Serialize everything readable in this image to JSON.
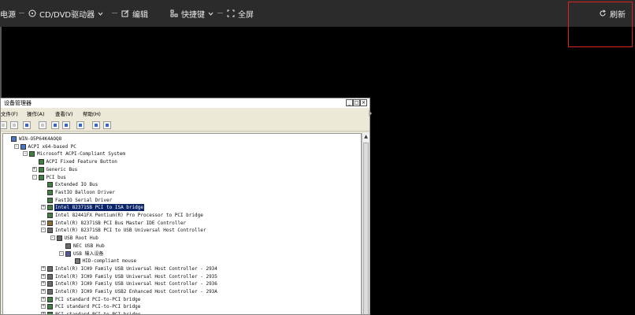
{
  "toolbar": {
    "cd_drive": "CD/DVD驱动器",
    "edit": "编辑",
    "shortcut": "快捷键",
    "fullscreen": "全屏",
    "refresh": "刷新",
    "power": "电源"
  },
  "window": {
    "title": "设备管理器",
    "controls": [
      "_",
      "□",
      "×"
    ],
    "menu": [
      "文件(F)",
      "操作(A)",
      "查看(V)",
      "帮助(H)"
    ]
  },
  "tree": [
    {
      "label": "WIN-O5P64K4AOQ8",
      "level": 0,
      "exp": "",
      "icon": "computer"
    },
    {
      "label": "ACPI x64-based PC",
      "level": 1,
      "exp": "-",
      "icon": "computer"
    },
    {
      "label": "Microsoft ACPI-Compliant System",
      "level": 2,
      "exp": "-",
      "icon": "chip"
    },
    {
      "label": "ACPI Fixed Feature Button",
      "level": 3,
      "exp": "",
      "icon": "chip"
    },
    {
      "label": "Generic Bus",
      "level": 3,
      "exp": "+",
      "icon": "chip"
    },
    {
      "label": "PCI bus",
      "level": 3,
      "exp": "-",
      "icon": "chip"
    },
    {
      "label": "Extended IO Bus",
      "level": 4,
      "exp": "",
      "icon": "chip"
    },
    {
      "label": "FastIO Balloon Driver",
      "level": 4,
      "exp": "",
      "icon": "chip"
    },
    {
      "label": "FastIO Serial Driver",
      "level": 4,
      "exp": "",
      "icon": "chip"
    },
    {
      "label": "Intel 82371SB PCI to ISA bridge",
      "level": 4,
      "exp": "+",
      "icon": "chip",
      "selected": true
    },
    {
      "label": "Intel 82441FX Pentium(R) Pro Processor to PCI bridge",
      "level": 4,
      "exp": "",
      "icon": "chip"
    },
    {
      "label": "Intel(R) 82371SB PCI Bus Master IDE Controller",
      "level": 4,
      "exp": "+",
      "icon": "disk"
    },
    {
      "label": "Intel(R) 82371SB PCI to USB Universal Host Controller",
      "level": 4,
      "exp": "-",
      "icon": "usb"
    },
    {
      "label": "USB Root Hub",
      "level": 5,
      "exp": "-",
      "icon": "usb"
    },
    {
      "label": "NEC USB Hub",
      "level": 6,
      "exp": "",
      "icon": "usb"
    },
    {
      "label": "USB 输入设备",
      "level": 6,
      "exp": "-",
      "icon": "input"
    },
    {
      "label": "HID-compliant mouse",
      "level": 7,
      "exp": "",
      "icon": "mouse"
    },
    {
      "label": "Intel(R) ICH9 Family USB Universal Host Controller - 2934",
      "level": 4,
      "exp": "+",
      "icon": "usb"
    },
    {
      "label": "Intel(R) ICH9 Family USB Universal Host Controller - 2935",
      "level": 4,
      "exp": "+",
      "icon": "usb"
    },
    {
      "label": "Intel(R) ICH9 Family USB Universal Host Controller - 2936",
      "level": 4,
      "exp": "+",
      "icon": "usb"
    },
    {
      "label": "Intel(R) ICH9 Family USB2 Enhanced Host Controller - 293A",
      "level": 4,
      "exp": "+",
      "icon": "usb"
    },
    {
      "label": "PCI standard PCI-to-PCI bridge",
      "level": 4,
      "exp": "+",
      "icon": "chip"
    },
    {
      "label": "PCI standard PCI-to-PCI bridge",
      "level": 4,
      "exp": "+",
      "icon": "chip"
    },
    {
      "label": "PCI standard PCI-to-PCI bridge",
      "level": 4,
      "exp": "+",
      "icon": "chip"
    }
  ],
  "colors": {
    "topbar": "#2b2b2b",
    "highlight": "#dd2222",
    "selection": "#0a246a"
  }
}
